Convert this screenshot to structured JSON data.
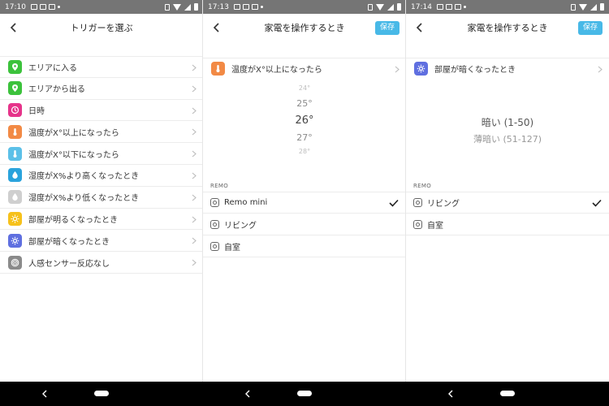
{
  "screens": [
    {
      "status_time": "17:10",
      "title": "トリガーを選ぶ",
      "items": [
        {
          "label": "エリアに入る",
          "icon": "location-pin-icon",
          "color": "#3cc23c"
        },
        {
          "label": "エリアから出る",
          "icon": "location-pin-icon",
          "color": "#3cc23c"
        },
        {
          "label": "日時",
          "icon": "clock-icon",
          "color": "#e6338a"
        },
        {
          "label": "温度がX°以上になったら",
          "icon": "thermometer-icon",
          "color": "#f28a45"
        },
        {
          "label": "温度がX°以下になったら",
          "icon": "thermometer-icon",
          "color": "#5cc0e8"
        },
        {
          "label": "湿度がX%より高くなったとき",
          "icon": "water-drop-icon",
          "color": "#2aa3dc"
        },
        {
          "label": "湿度がX%より低くなったとき",
          "icon": "water-drop-icon",
          "color": "#cfcfcf"
        },
        {
          "label": "部屋が明るくなったとき",
          "icon": "sun-icon",
          "color": "#f6c11b"
        },
        {
          "label": "部屋が暗くなったとき",
          "icon": "gear-sun-icon",
          "color": "#5f6fe0"
        },
        {
          "label": "人感センサー反応なし",
          "icon": "motion-sensor-icon",
          "color": "#8a8a8a"
        }
      ]
    },
    {
      "status_time": "17:13",
      "title": "家電を操作するとき",
      "save_label": "保存",
      "trigger": {
        "label": "温度がX°以上になったら",
        "icon": "thermometer-icon",
        "color": "#f28a45"
      },
      "picker": [
        "24°",
        "25°",
        "26°",
        "27°",
        "28°"
      ],
      "picker_selected": "26°",
      "section": "REMO",
      "options": [
        {
          "label": "Remo mini",
          "checked": true
        },
        {
          "label": "リビング",
          "checked": false
        },
        {
          "label": "自室",
          "checked": false
        }
      ]
    },
    {
      "status_time": "17:14",
      "title": "家電を操作するとき",
      "save_label": "保存",
      "trigger": {
        "label": "部屋が暗くなったとき",
        "icon": "gear-sun-icon",
        "color": "#5f6fe0"
      },
      "levels": [
        "暗い (1-50)",
        "薄暗い (51-127)"
      ],
      "section": "REMO",
      "options": [
        {
          "label": "リビング",
          "checked": true
        },
        {
          "label": "自室",
          "checked": false
        }
      ]
    }
  ],
  "colors": {
    "accent": "#48b9e7",
    "statusbar": "#757575",
    "navbar": "#000000"
  }
}
